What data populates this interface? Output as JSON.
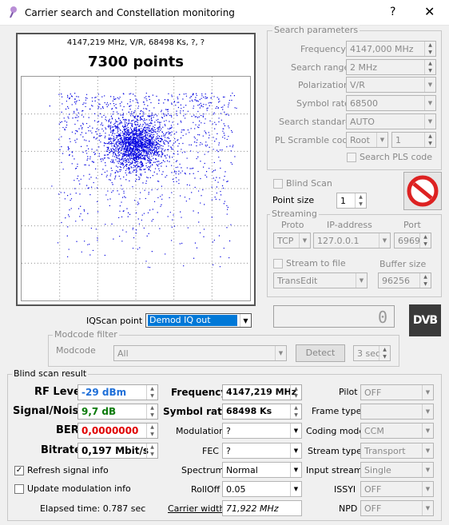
{
  "window": {
    "title": "Carrier search and Constellation monitoring",
    "help_label": "?",
    "close_label": "✕"
  },
  "plot": {
    "info": "4147,219 MHz, V/R, 68498 Ks, ?, ?",
    "points_label": "7300 points"
  },
  "search": {
    "group_label": "Search parameters",
    "frequency_label": "Frequency",
    "frequency_value": "4147,000 MHz",
    "range_label": "Search range",
    "range_value": "2 MHz",
    "polarization_label": "Polarization",
    "polarization_value": "V/R",
    "symbol_rate_label": "Symbol rate",
    "symbol_rate_value": "68500",
    "standard_label": "Search standard",
    "standard_value": "AUTO",
    "pl_label": "PL Scramble code",
    "pl_mode_value": "Root",
    "pl_value": "1",
    "pls_label": "Search PLS code"
  },
  "blind": {
    "label": "Blind Scan",
    "point_size_label": "Point size",
    "point_size_value": "1"
  },
  "streaming": {
    "group_label": "Streaming",
    "proto_label": "Proto",
    "ip_label": "IP-address",
    "port_label": "Port",
    "proto_value": "TCP",
    "ip_value": "127.0.0.1",
    "port_value": "6969",
    "stream_file_label": "Stream to file",
    "buffer_label": "Buffer size",
    "file_value": "TransEdit",
    "buffer_value": "96256"
  },
  "counter_value": "0",
  "dvb_logo": "DVB",
  "iq": {
    "label": "IQScan point",
    "value": "Demod IQ out"
  },
  "modcode": {
    "group_label": "Modcode filter",
    "label": "Modcode",
    "value": "All",
    "detect_label": "Detect",
    "time_value": "3 sec"
  },
  "result": {
    "group_label": "Blind scan result",
    "rf_label": "RF Level",
    "rf_value": "-29 dBm",
    "sn_label": "Signal/Noise",
    "sn_value": "9,7 dB",
    "ber_label": "BER",
    "ber_value": "0,0000000",
    "bitrate_label": "Bitrate",
    "bitrate_value": "0,197 Mbit/s",
    "refresh_label": "Refresh signal info",
    "update_label": "Update modulation info",
    "elapsed": "Elapsed time: 0.787 sec",
    "freq_label": "Frequency",
    "freq_value": "4147,219 MHz",
    "sr_label": "Symbol rate",
    "sr_value": "68498 Ks",
    "mod_label": "Modulation",
    "mod_value": "?",
    "fec_label": "FEC",
    "fec_value": "?",
    "spectrum_label": "Spectrum",
    "spectrum_value": "Normal",
    "rolloff_label": "RollOff",
    "rolloff_value": "0.05",
    "cw_label": "Carrier width",
    "cw_value": "71,922 MHz",
    "pilot_label": "Pilot",
    "pilot_value": "OFF",
    "frame_label": "Frame type",
    "frame_value": "",
    "coding_label": "Coding mode",
    "coding_value": "CCM",
    "stype_label": "Stream type",
    "stype_value": "Transport",
    "istream_label": "Input stream",
    "istream_value": "Single",
    "issyi_label": "ISSYI",
    "issyi_value": "OFF",
    "npd_label": "NPD",
    "npd_value": "OFF"
  },
  "colors": {
    "rf": "#1e6fd8",
    "sn": "#0a7a0a",
    "ber": "#e00000",
    "points": "#0000e0"
  },
  "chart_data": {
    "type": "scatter",
    "points_count": 7300,
    "cluster_center": [
      0.45,
      0.3
    ],
    "grid": true
  }
}
